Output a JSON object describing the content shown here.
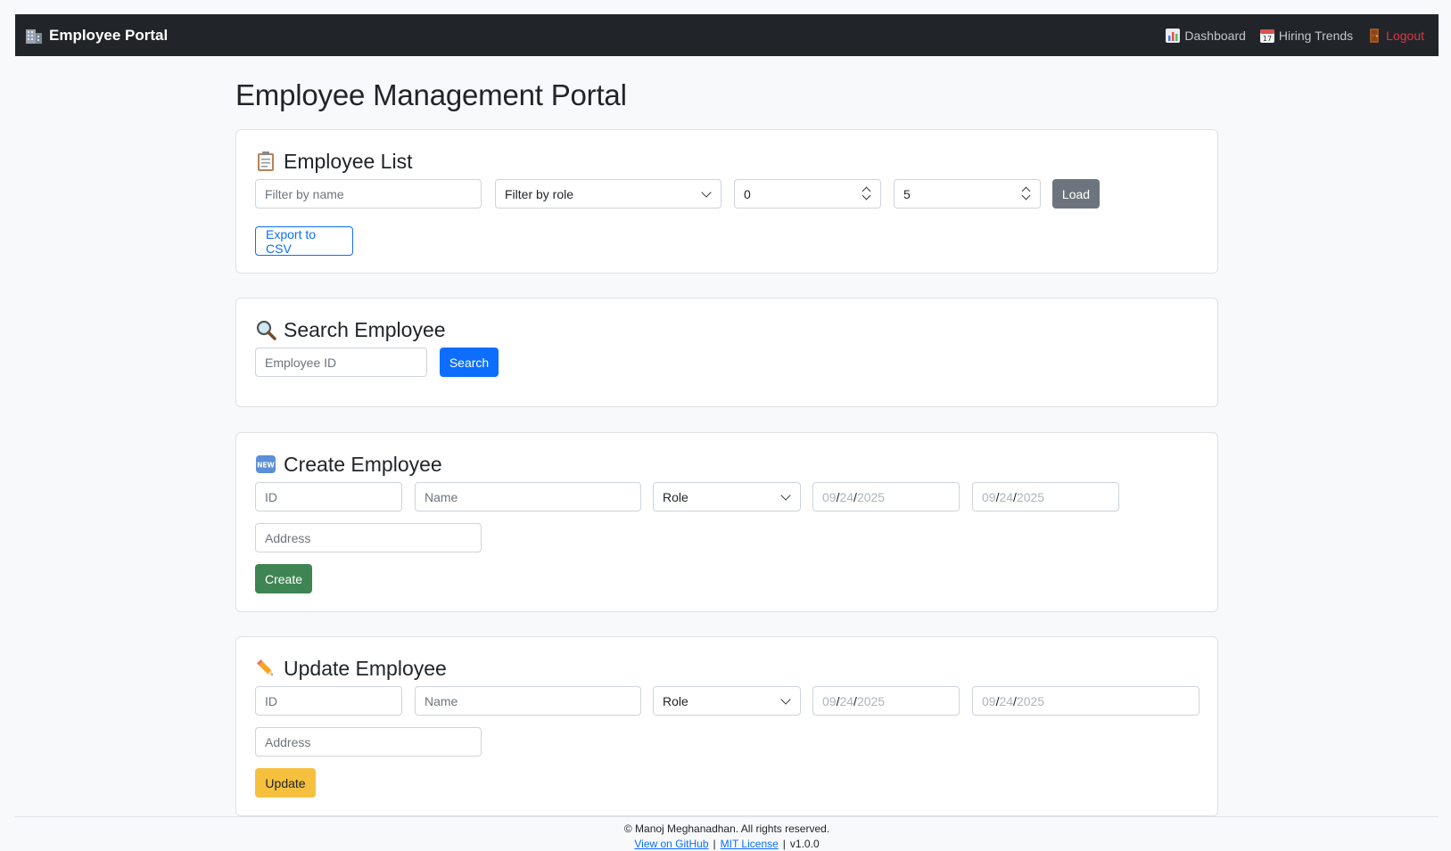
{
  "navbar": {
    "brand": "Employee Portal",
    "brand_icon": "office-building-icon",
    "links": [
      {
        "label": "Dashboard",
        "icon": "bar-chart-icon"
      },
      {
        "label": "Hiring Trends",
        "icon": "calendar-icon"
      },
      {
        "label": "Logout",
        "icon": "door-icon",
        "color": "#dc3545"
      }
    ]
  },
  "page_title": "Employee Management Portal",
  "employee_list": {
    "title": "Employee List",
    "icon": "clipboard-icon",
    "name_placeholder": "Filter by name",
    "role_select": "Filter by role",
    "page_value": "0",
    "size_value": "5",
    "load_label": "Load",
    "export_label": "Export to CSV"
  },
  "search": {
    "title": "Search Employee",
    "icon": "magnifier-icon",
    "id_placeholder": "Employee ID",
    "search_label": "Search"
  },
  "create": {
    "title": "Create Employee",
    "icon": "new-badge-icon",
    "id_placeholder": "ID",
    "name_placeholder": "Name",
    "role_select": "Role",
    "date_mm": "09",
    "date_dd": "24",
    "date_yyyy": "2025",
    "address_placeholder": "Address",
    "create_label": "Create"
  },
  "update": {
    "title": "Update Employee",
    "icon": "pencil-icon",
    "id_placeholder": "ID",
    "name_placeholder": "Name",
    "role_select": "Role",
    "date_mm": "09",
    "date_dd": "24",
    "date_yyyy": "2025",
    "address_placeholder": "Address",
    "update_label": "Update"
  },
  "footer": {
    "copyright": "© Manoj Meghanadhan. All rights reserved.",
    "github_label": "View on GitHub",
    "license_label": "MIT License",
    "sep": "|",
    "version": "v1.0.0"
  },
  "colors": {
    "navbar_bg": "#212529",
    "primary": "#0d6efd",
    "secondary": "#6c757d",
    "success": "#3f8553",
    "warning": "#f5c03e",
    "danger": "#dc3545"
  }
}
